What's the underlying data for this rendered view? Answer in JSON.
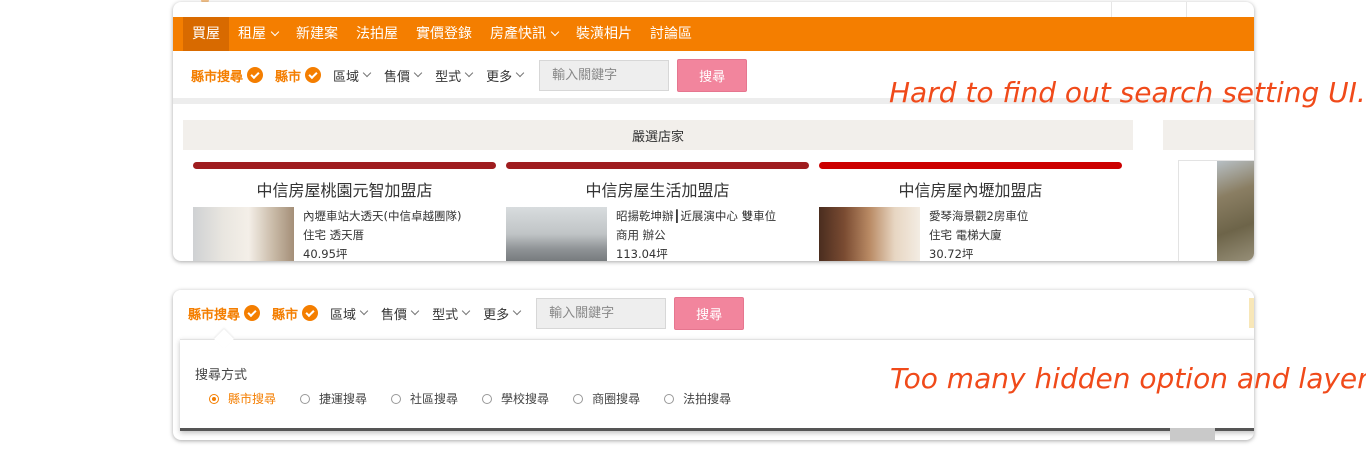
{
  "topnav": {
    "items": [
      {
        "label": "買屋",
        "dropdown": false,
        "active": true
      },
      {
        "label": "租屋",
        "dropdown": true
      },
      {
        "label": "新建案",
        "dropdown": false
      },
      {
        "label": "法拍屋",
        "dropdown": false
      },
      {
        "label": "實價登錄",
        "dropdown": false
      },
      {
        "label": "房產快訊",
        "dropdown": true
      },
      {
        "label": "裝潢相片",
        "dropdown": false
      },
      {
        "label": "討論區",
        "dropdown": false
      }
    ]
  },
  "filters": {
    "checked": [
      "縣市搜尋",
      "縣市"
    ],
    "dropdowns": [
      "區域",
      "售價",
      "型式",
      "更多"
    ],
    "keyword_placeholder": "輸入關鍵字",
    "search_label": "搜尋"
  },
  "section_title": "嚴選店家",
  "stores": [
    {
      "name": "中信房屋桃園元智加盟店",
      "listing_title": "內壢車站大透天(中信卓越團隊)",
      "listing_type": "住宅 透天厝",
      "listing_size": "40.95坪"
    },
    {
      "name": "中信房屋生活加盟店",
      "listing_title": "昭揚乾坤辦┃近展演中心 雙車位",
      "listing_type": "商用 辦公",
      "listing_size": "113.04坪"
    },
    {
      "name": "中信房屋內壢加盟店",
      "listing_title": "愛琴海景觀2房車位",
      "listing_type": "住宅 電梯大廈",
      "listing_size": "30.72坪"
    }
  ],
  "search_mode": {
    "label": "搜尋方式",
    "options": [
      "縣市搜尋",
      "捷運搜尋",
      "社區搜尋",
      "學校搜尋",
      "商圈搜尋",
      "法拍搜尋"
    ],
    "selected": "縣市搜尋"
  },
  "annotations": {
    "note1": "Hard to find out search setting UI.",
    "note2": "Too many hidden option and layer"
  },
  "colors": {
    "brand": "#f47e00",
    "search_button": "#f2859d",
    "note": "#f04a1a"
  }
}
